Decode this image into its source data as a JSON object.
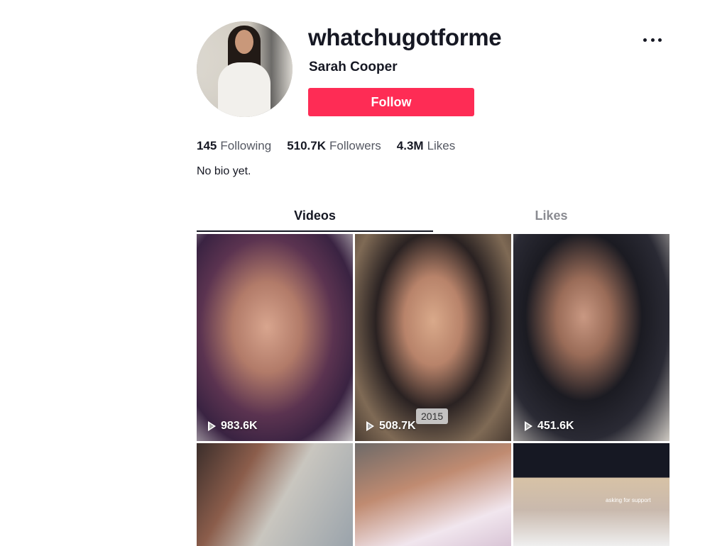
{
  "profile": {
    "username": "whatchugotforme",
    "nickname": "Sarah Cooper",
    "follow_label": "Follow",
    "bio": "No bio yet."
  },
  "stats": [
    {
      "value": "145",
      "label": "Following"
    },
    {
      "value": "510.7K",
      "label": "Followers"
    },
    {
      "value": "4.3M",
      "label": "Likes"
    }
  ],
  "tabs": [
    {
      "label": "Videos",
      "active": true
    },
    {
      "label": "Likes",
      "active": false
    }
  ],
  "videos": [
    {
      "views": "983.6K"
    },
    {
      "views": "508.7K",
      "tag": "2015"
    },
    {
      "views": "451.6K"
    },
    {
      "views": ""
    },
    {
      "views": ""
    },
    {
      "views": "",
      "overlay": "asking for support"
    }
  ],
  "icons": {
    "more": "more-options-icon",
    "play": "play-icon"
  }
}
